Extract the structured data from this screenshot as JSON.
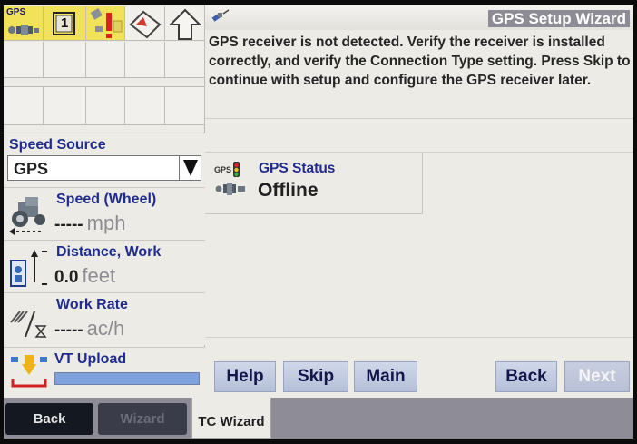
{
  "left_panel": {
    "top_tiles": [
      {
        "name": "gps-icon",
        "label": "GPS"
      },
      {
        "name": "slot-one-icon",
        "label": "1"
      },
      {
        "name": "alert-icon",
        "label": ""
      },
      {
        "name": "calibration-icon",
        "label": ""
      },
      {
        "name": "up-arrow-icon",
        "label": ""
      }
    ],
    "speed_source": {
      "label": "Speed Source",
      "value": "GPS"
    },
    "speed": {
      "label": "Speed (Wheel)",
      "value": "-----",
      "unit": "mph",
      "icon": "tractor-icon"
    },
    "distance": {
      "label": "Distance, Work",
      "value": "0.0",
      "unit": "feet",
      "icon": "distance-counter-icon"
    },
    "work_rate": {
      "label": "Work Rate",
      "value": "-----",
      "unit": "ac/h",
      "icon": "work-rate-icon"
    },
    "vt_upload": {
      "label": "VT Upload",
      "icon": "upload-icon",
      "progress": 1.0
    }
  },
  "wizard": {
    "title": "GPS Setup Wizard",
    "message": "GPS receiver is not detected. Verify the receiver is installed correctly, and verify the Connection Type setting. Press Skip to continue with setup and configure the GPS receiver later.",
    "gps_status": {
      "small_label": "GPS",
      "label": "GPS Status",
      "value": "Offline"
    },
    "buttons": {
      "help": "Help",
      "skip": "Skip",
      "main": "Main",
      "back": "Back",
      "next": "Next"
    }
  },
  "bottom_nav": {
    "back": "Back",
    "wizard": "Wizard",
    "tc_wizard": "TC Wizard"
  },
  "colors": {
    "label_blue": "#1f2c8e",
    "button_blue": "#c4cce2",
    "tile_active_yellow": "#f1e25a",
    "nav_gray": "#8e8d97"
  }
}
